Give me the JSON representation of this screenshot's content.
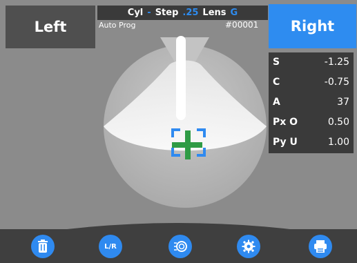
{
  "top": {
    "left_label": "Left",
    "right_label": "Right",
    "cyl_label": "Cyl",
    "cyl_value": "-",
    "step_label": "Step",
    "step_value": ".25",
    "lens_label": "Lens",
    "lens_value": "G",
    "auto_prog": "Auto Prog",
    "job_no": "#00001"
  },
  "values": [
    {
      "label": "S",
      "value": "-1.25"
    },
    {
      "label": "C",
      "value": "-0.75"
    },
    {
      "label": "A",
      "value": "37"
    },
    {
      "label": "Px O",
      "value": "0.50"
    },
    {
      "label": "Py U",
      "value": "1.00"
    }
  ],
  "toolbar": {
    "lr_label": "L/R",
    "icons": [
      "trash-icon",
      "lr-icon",
      "lens-icon",
      "gear-icon",
      "print-icon"
    ]
  },
  "colors": {
    "accent": "#2e8cf0",
    "dark": "#3a3a3a",
    "panel": "#8b8b8b",
    "crosshair": "#2f9b45"
  }
}
